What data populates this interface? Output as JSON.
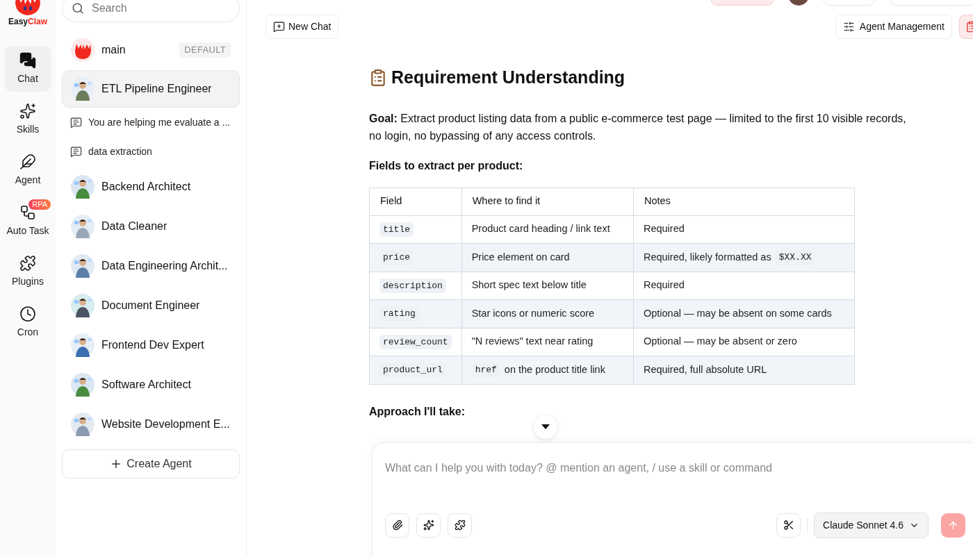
{
  "logo": {
    "word_1": "Easy",
    "word_2": "Claw"
  },
  "rail": [
    {
      "label": "Chat",
      "selected": true
    },
    {
      "label": "Skills",
      "selected": false
    },
    {
      "label": "Agent",
      "selected": false
    },
    {
      "label": "Auto Task",
      "selected": false,
      "badge": "RPA"
    },
    {
      "label": "Plugins",
      "selected": false
    },
    {
      "label": "Cron",
      "selected": false
    }
  ],
  "agents": {
    "search": {
      "placeholder": "Search"
    },
    "items": [
      {
        "kind": "main",
        "name": "main",
        "badge": "DEFAULT",
        "selected": false
      },
      {
        "kind": "agent",
        "name": "ETL Pipeline Engineer",
        "selected": true,
        "children": [
          {
            "kind": "chat",
            "name": "You are helping me evaluate a ...",
            "selected": false
          },
          {
            "kind": "chat",
            "name": "data extraction",
            "selected": false
          }
        ]
      },
      {
        "kind": "agent",
        "name": "Backend Architect",
        "selected": false
      },
      {
        "kind": "agent",
        "name": "Data Cleaner",
        "selected": false
      },
      {
        "kind": "agent",
        "name": "Data Engineering Archit...",
        "selected": false
      },
      {
        "kind": "agent",
        "name": "Document Engineer",
        "selected": false
      },
      {
        "kind": "agent",
        "name": "Frontend Dev Expert",
        "selected": false
      },
      {
        "kind": "agent",
        "name": "Software Architect",
        "selected": false
      },
      {
        "kind": "agent",
        "name": "Website Development E...",
        "selected": false
      }
    ],
    "create_button": "Create Agent"
  },
  "header": {
    "new_chat": "New Chat",
    "agent_management": "Agent Management"
  },
  "message": {
    "heading": "Requirement Understanding",
    "goal": "**Goal:** Extract product listing data from a public e-commerce test page — limited to the first 10 visible records, no login, no bypassing of any access controls.",
    "fields_heading": "Fields to extract per product:",
    "table": {
      "columns": [
        "Field",
        "Where to find it",
        "Notes"
      ],
      "rows": [
        [
          [
            {
              "kind": "code",
              "text": "title"
            }
          ],
          [
            {
              "kind": "text",
              "text": "Product card heading / link text"
            }
          ],
          [
            {
              "kind": "text",
              "text": "Required"
            }
          ]
        ],
        [
          [
            {
              "kind": "code",
              "text": "price"
            }
          ],
          [
            {
              "kind": "text",
              "text": "Price element on card"
            }
          ],
          [
            {
              "kind": "text",
              "text": "Required, likely formatted as"
            },
            {
              "kind": "code",
              "text": "$XX.XX"
            }
          ]
        ],
        [
          [
            {
              "kind": "code",
              "text": "description"
            }
          ],
          [
            {
              "kind": "text",
              "text": "Short spec text below title"
            }
          ],
          [
            {
              "kind": "text",
              "text": "Required"
            }
          ]
        ],
        [
          [
            {
              "kind": "code",
              "text": "rating"
            }
          ],
          [
            {
              "kind": "text",
              "text": "Star icons or numeric score"
            }
          ],
          [
            {
              "kind": "text",
              "text": "Optional — may be absent on some cards"
            }
          ]
        ],
        [
          [
            {
              "kind": "code",
              "text": "review_count"
            }
          ],
          [
            {
              "kind": "text",
              "text": "\"N reviews\" text near rating"
            }
          ],
          [
            {
              "kind": "text",
              "text": "Optional — may be absent or zero"
            }
          ]
        ],
        [
          [
            {
              "kind": "code",
              "text": "product_url"
            }
          ],
          [
            {
              "kind": "code",
              "text": "href"
            },
            {
              "kind": "text",
              "text": "on the product title link"
            }
          ],
          [
            {
              "kind": "text",
              "text": "Required, full absolute URL"
            }
          ]
        ]
      ]
    },
    "approach_heading": "Approach I'll take:"
  },
  "composer": {
    "placeholder": "What can I help you with today? @ mention an agent, / use a skill or command",
    "model": "Claude Sonnet 4.6",
    "send_disabled": true
  }
}
